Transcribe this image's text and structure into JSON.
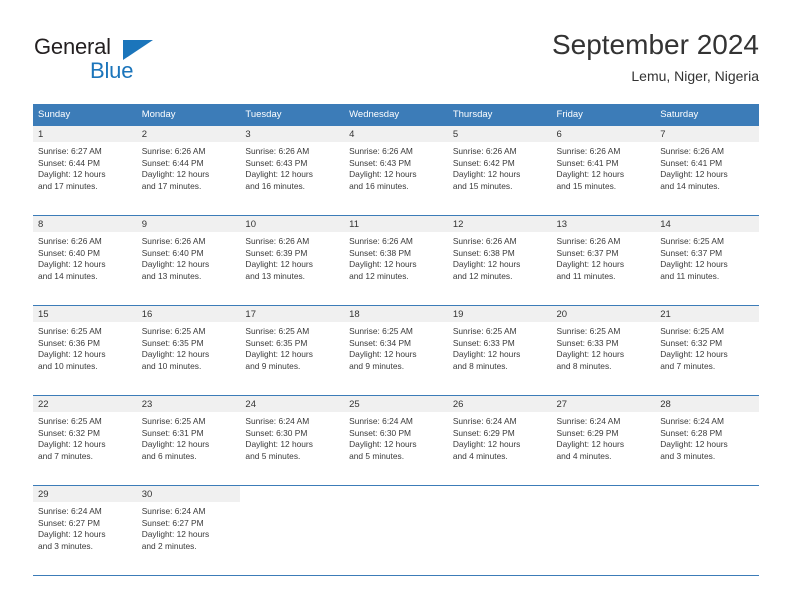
{
  "brand": {
    "name_primary": "General",
    "name_secondary": "Blue",
    "triangle_color": "#1b75bb"
  },
  "header": {
    "title": "September 2024",
    "subtitle": "Lemu, Niger, Nigeria"
  },
  "theme": {
    "header_blue": "#3c7cb8",
    "daynum_band": "#f0f0f0",
    "text": "#333333"
  },
  "calendar": {
    "weekday_headers": [
      "Sunday",
      "Monday",
      "Tuesday",
      "Wednesday",
      "Thursday",
      "Friday",
      "Saturday"
    ],
    "weeks": [
      [
        {
          "day": "1",
          "sunrise": "Sunrise: 6:27 AM",
          "sunset": "Sunset: 6:44 PM",
          "daylight1": "Daylight: 12 hours",
          "daylight2": "and 17 minutes."
        },
        {
          "day": "2",
          "sunrise": "Sunrise: 6:26 AM",
          "sunset": "Sunset: 6:44 PM",
          "daylight1": "Daylight: 12 hours",
          "daylight2": "and 17 minutes."
        },
        {
          "day": "3",
          "sunrise": "Sunrise: 6:26 AM",
          "sunset": "Sunset: 6:43 PM",
          "daylight1": "Daylight: 12 hours",
          "daylight2": "and 16 minutes."
        },
        {
          "day": "4",
          "sunrise": "Sunrise: 6:26 AM",
          "sunset": "Sunset: 6:43 PM",
          "daylight1": "Daylight: 12 hours",
          "daylight2": "and 16 minutes."
        },
        {
          "day": "5",
          "sunrise": "Sunrise: 6:26 AM",
          "sunset": "Sunset: 6:42 PM",
          "daylight1": "Daylight: 12 hours",
          "daylight2": "and 15 minutes."
        },
        {
          "day": "6",
          "sunrise": "Sunrise: 6:26 AM",
          "sunset": "Sunset: 6:41 PM",
          "daylight1": "Daylight: 12 hours",
          "daylight2": "and 15 minutes."
        },
        {
          "day": "7",
          "sunrise": "Sunrise: 6:26 AM",
          "sunset": "Sunset: 6:41 PM",
          "daylight1": "Daylight: 12 hours",
          "daylight2": "and 14 minutes."
        }
      ],
      [
        {
          "day": "8",
          "sunrise": "Sunrise: 6:26 AM",
          "sunset": "Sunset: 6:40 PM",
          "daylight1": "Daylight: 12 hours",
          "daylight2": "and 14 minutes."
        },
        {
          "day": "9",
          "sunrise": "Sunrise: 6:26 AM",
          "sunset": "Sunset: 6:40 PM",
          "daylight1": "Daylight: 12 hours",
          "daylight2": "and 13 minutes."
        },
        {
          "day": "10",
          "sunrise": "Sunrise: 6:26 AM",
          "sunset": "Sunset: 6:39 PM",
          "daylight1": "Daylight: 12 hours",
          "daylight2": "and 13 minutes."
        },
        {
          "day": "11",
          "sunrise": "Sunrise: 6:26 AM",
          "sunset": "Sunset: 6:38 PM",
          "daylight1": "Daylight: 12 hours",
          "daylight2": "and 12 minutes."
        },
        {
          "day": "12",
          "sunrise": "Sunrise: 6:26 AM",
          "sunset": "Sunset: 6:38 PM",
          "daylight1": "Daylight: 12 hours",
          "daylight2": "and 12 minutes."
        },
        {
          "day": "13",
          "sunrise": "Sunrise: 6:26 AM",
          "sunset": "Sunset: 6:37 PM",
          "daylight1": "Daylight: 12 hours",
          "daylight2": "and 11 minutes."
        },
        {
          "day": "14",
          "sunrise": "Sunrise: 6:25 AM",
          "sunset": "Sunset: 6:37 PM",
          "daylight1": "Daylight: 12 hours",
          "daylight2": "and 11 minutes."
        }
      ],
      [
        {
          "day": "15",
          "sunrise": "Sunrise: 6:25 AM",
          "sunset": "Sunset: 6:36 PM",
          "daylight1": "Daylight: 12 hours",
          "daylight2": "and 10 minutes."
        },
        {
          "day": "16",
          "sunrise": "Sunrise: 6:25 AM",
          "sunset": "Sunset: 6:35 PM",
          "daylight1": "Daylight: 12 hours",
          "daylight2": "and 10 minutes."
        },
        {
          "day": "17",
          "sunrise": "Sunrise: 6:25 AM",
          "sunset": "Sunset: 6:35 PM",
          "daylight1": "Daylight: 12 hours",
          "daylight2": "and 9 minutes."
        },
        {
          "day": "18",
          "sunrise": "Sunrise: 6:25 AM",
          "sunset": "Sunset: 6:34 PM",
          "daylight1": "Daylight: 12 hours",
          "daylight2": "and 9 minutes."
        },
        {
          "day": "19",
          "sunrise": "Sunrise: 6:25 AM",
          "sunset": "Sunset: 6:33 PM",
          "daylight1": "Daylight: 12 hours",
          "daylight2": "and 8 minutes."
        },
        {
          "day": "20",
          "sunrise": "Sunrise: 6:25 AM",
          "sunset": "Sunset: 6:33 PM",
          "daylight1": "Daylight: 12 hours",
          "daylight2": "and 8 minutes."
        },
        {
          "day": "21",
          "sunrise": "Sunrise: 6:25 AM",
          "sunset": "Sunset: 6:32 PM",
          "daylight1": "Daylight: 12 hours",
          "daylight2": "and 7 minutes."
        }
      ],
      [
        {
          "day": "22",
          "sunrise": "Sunrise: 6:25 AM",
          "sunset": "Sunset: 6:32 PM",
          "daylight1": "Daylight: 12 hours",
          "daylight2": "and 7 minutes."
        },
        {
          "day": "23",
          "sunrise": "Sunrise: 6:25 AM",
          "sunset": "Sunset: 6:31 PM",
          "daylight1": "Daylight: 12 hours",
          "daylight2": "and 6 minutes."
        },
        {
          "day": "24",
          "sunrise": "Sunrise: 6:24 AM",
          "sunset": "Sunset: 6:30 PM",
          "daylight1": "Daylight: 12 hours",
          "daylight2": "and 5 minutes."
        },
        {
          "day": "25",
          "sunrise": "Sunrise: 6:24 AM",
          "sunset": "Sunset: 6:30 PM",
          "daylight1": "Daylight: 12 hours",
          "daylight2": "and 5 minutes."
        },
        {
          "day": "26",
          "sunrise": "Sunrise: 6:24 AM",
          "sunset": "Sunset: 6:29 PM",
          "daylight1": "Daylight: 12 hours",
          "daylight2": "and 4 minutes."
        },
        {
          "day": "27",
          "sunrise": "Sunrise: 6:24 AM",
          "sunset": "Sunset: 6:29 PM",
          "daylight1": "Daylight: 12 hours",
          "daylight2": "and 4 minutes."
        },
        {
          "day": "28",
          "sunrise": "Sunrise: 6:24 AM",
          "sunset": "Sunset: 6:28 PM",
          "daylight1": "Daylight: 12 hours",
          "daylight2": "and 3 minutes."
        }
      ],
      [
        {
          "day": "29",
          "sunrise": "Sunrise: 6:24 AM",
          "sunset": "Sunset: 6:27 PM",
          "daylight1": "Daylight: 12 hours",
          "daylight2": "and 3 minutes."
        },
        {
          "day": "30",
          "sunrise": "Sunrise: 6:24 AM",
          "sunset": "Sunset: 6:27 PM",
          "daylight1": "Daylight: 12 hours",
          "daylight2": "and 2 minutes."
        },
        {
          "day": "",
          "sunrise": "",
          "sunset": "",
          "daylight1": "",
          "daylight2": ""
        },
        {
          "day": "",
          "sunrise": "",
          "sunset": "",
          "daylight1": "",
          "daylight2": ""
        },
        {
          "day": "",
          "sunrise": "",
          "sunset": "",
          "daylight1": "",
          "daylight2": ""
        },
        {
          "day": "",
          "sunrise": "",
          "sunset": "",
          "daylight1": "",
          "daylight2": ""
        },
        {
          "day": "",
          "sunrise": "",
          "sunset": "",
          "daylight1": "",
          "daylight2": ""
        }
      ]
    ]
  }
}
